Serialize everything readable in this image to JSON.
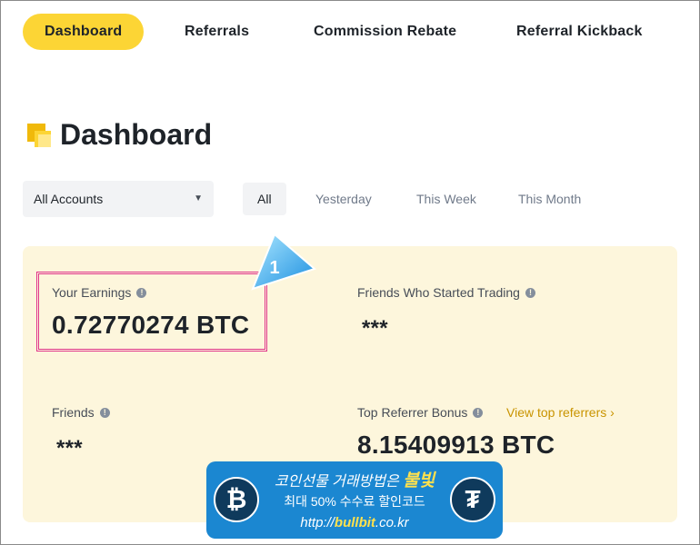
{
  "nav": {
    "tabs": [
      {
        "label": "Dashboard",
        "active": true
      },
      {
        "label": "Referrals",
        "active": false
      },
      {
        "label": "Commission Rebate",
        "active": false
      },
      {
        "label": "Referral Kickback",
        "active": false
      }
    ]
  },
  "page": {
    "title": "Dashboard"
  },
  "filters": {
    "account": "All Accounts",
    "periods": [
      "All",
      "Yesterday",
      "This Week",
      "This Month"
    ],
    "active_period": "All"
  },
  "stats": {
    "earnings": {
      "label": "Your Earnings",
      "value": "0.72770274 BTC"
    },
    "friends_trading": {
      "label": "Friends Who Started Trading",
      "value": "***"
    },
    "friends": {
      "label": "Friends",
      "value": "***"
    },
    "top_bonus": {
      "label": "Top Referrer Bonus",
      "value": "8.15409913 BTC",
      "link": "View top referrers ›"
    }
  },
  "annotation": {
    "callout_number": "1"
  },
  "banner": {
    "line1_prefix": "코인선물 거래방법은 ",
    "line1_brand": "불빛",
    "line2": "최대 50% 수수료 할인코드",
    "line3_prefix": "http://",
    "line3_brand": "bullbit",
    "line3_suffix": ".co.kr",
    "btc_symbol": "₿",
    "usdt_symbol": "₮"
  },
  "colors": {
    "accent": "#fcd535",
    "panel_bg": "#fdf6dc",
    "link": "#c99400",
    "highlight_border": "#e0348a",
    "banner_bg": "#1b87d1"
  }
}
